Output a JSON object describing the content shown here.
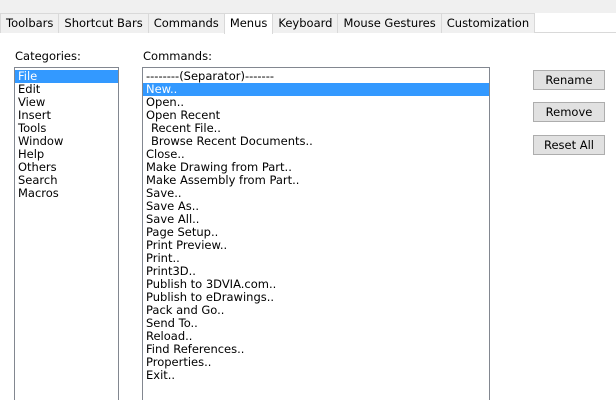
{
  "tabs": [
    {
      "label": "Toolbars",
      "active": false
    },
    {
      "label": "Shortcut Bars",
      "active": false
    },
    {
      "label": "Commands",
      "active": false
    },
    {
      "label": "Menus",
      "active": true
    },
    {
      "label": "Keyboard",
      "active": false
    },
    {
      "label": "Mouse Gestures",
      "active": false
    },
    {
      "label": "Customization",
      "active": false
    }
  ],
  "categories": {
    "label": "Categories:",
    "selected": "File",
    "items": [
      "File",
      "Edit",
      "View",
      "Insert",
      "Tools",
      "Window",
      "Help",
      "Others",
      "Search",
      "Macros"
    ]
  },
  "commands": {
    "label": "Commands:",
    "selected": "New..",
    "items": [
      {
        "text": "--------(Separator)-------",
        "indent": false
      },
      {
        "text": "New..",
        "indent": false
      },
      {
        "text": "Open..",
        "indent": false
      },
      {
        "text": "Open Recent",
        "indent": false
      },
      {
        "text": "Recent File..",
        "indent": true
      },
      {
        "text": "Browse Recent Documents..",
        "indent": true
      },
      {
        "text": "Close..",
        "indent": false
      },
      {
        "text": "Make Drawing from Part..",
        "indent": false
      },
      {
        "text": "Make Assembly from Part..",
        "indent": false
      },
      {
        "text": "Save..",
        "indent": false
      },
      {
        "text": "Save As..",
        "indent": false
      },
      {
        "text": "Save All..",
        "indent": false
      },
      {
        "text": "Page Setup..",
        "indent": false
      },
      {
        "text": "Print Preview..",
        "indent": false
      },
      {
        "text": "Print..",
        "indent": false
      },
      {
        "text": "Print3D..",
        "indent": false
      },
      {
        "text": "Publish to 3DVIA.com..",
        "indent": false
      },
      {
        "text": "Publish to eDrawings..",
        "indent": false
      },
      {
        "text": "Pack and Go..",
        "indent": false
      },
      {
        "text": "Send To..",
        "indent": false
      },
      {
        "text": "Reload..",
        "indent": false
      },
      {
        "text": "Find References..",
        "indent": false
      },
      {
        "text": "Properties..",
        "indent": false
      },
      {
        "text": "Exit..",
        "indent": false
      }
    ]
  },
  "buttons": {
    "rename": "Rename",
    "remove": "Remove",
    "reset_all": "Reset All"
  },
  "colors": {
    "selection": "#3399ff",
    "tab_bg": "#f0f0f0",
    "button_bg": "#e1e1e1"
  }
}
